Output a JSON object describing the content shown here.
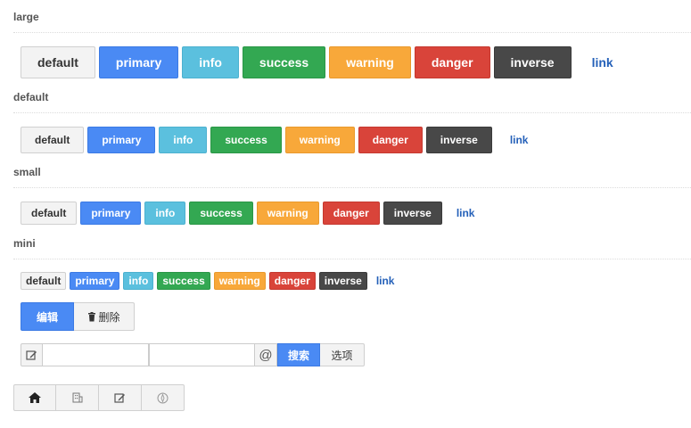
{
  "sections": {
    "large": "large",
    "default": "default",
    "small": "small",
    "mini": "mini"
  },
  "buttons": {
    "default": "default",
    "primary": "primary",
    "info": "info",
    "success": "success",
    "warning": "warning",
    "danger": "danger",
    "inverse": "inverse",
    "link": "link"
  },
  "edit_group": {
    "edit": "编辑",
    "delete_icon": "trash-icon",
    "delete": "删除"
  },
  "search_row": {
    "edit_icon": "edit-icon",
    "input1_value": "",
    "input2_value": "",
    "at_symbol": "@",
    "search": "搜索",
    "options": "选项"
  },
  "icon_toolbar": [
    "home-icon",
    "building-icon",
    "edit-icon",
    "compass-icon"
  ],
  "colors": {
    "default": "#f3f3f3",
    "primary": "#4a8af4",
    "info": "#5bc0de",
    "success": "#33a852",
    "warning": "#f8a83a",
    "danger": "#d9443a",
    "inverse": "#484848",
    "link": "#2561b9"
  }
}
